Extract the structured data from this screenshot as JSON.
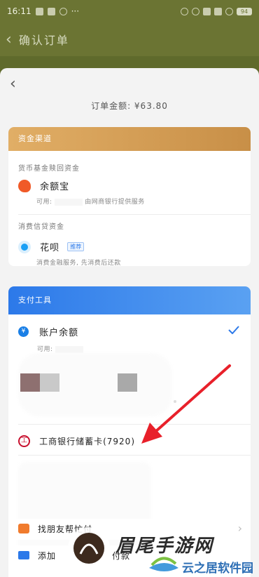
{
  "status_bar": {
    "time": "16:11",
    "battery": "94"
  },
  "background_page": {
    "title": "确认订单"
  },
  "sheet": {
    "order_amount_label": "订单金额: ¥63.80"
  },
  "funding": {
    "header": "资金渠道",
    "fund_section_title": "货币基金赎回资金",
    "yuebao": {
      "name": "余额宝",
      "sub_prefix": "可用:",
      "sub_suffix": "由网商银行提供服务"
    },
    "credit_section_title": "消费信贷资金",
    "huabei": {
      "name": "花呗",
      "tag": "推荐",
      "sub": "消费金融服务, 先消费后还款"
    }
  },
  "payment": {
    "header": "支付工具",
    "balance": {
      "name": "账户余额",
      "sub_prefix": "可用:"
    },
    "bank_card": {
      "name": "工商银行储蓄卡(7920)"
    },
    "friend_pay": {
      "name": "找朋友帮忙付"
    },
    "add_card": {
      "name": "添加",
      "name_tail": "付款"
    }
  },
  "watermark": {
    "brand": "眉尾手游网",
    "sub": "云之居软件园"
  },
  "colors": {
    "funding_header": "#d49e55",
    "payment_header": "#2c79e9",
    "annotation_arrow": "#e8202a",
    "check": "#2c79e9"
  }
}
